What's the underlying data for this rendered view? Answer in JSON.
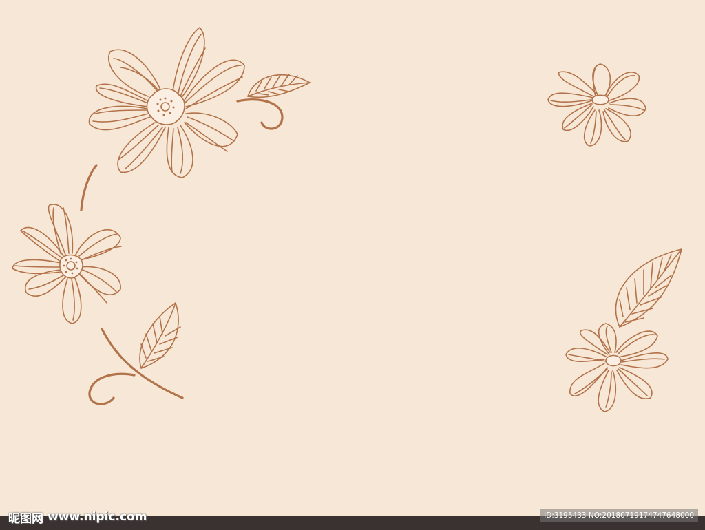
{
  "background_color": "#f7e7d6",
  "line_color": "#b2734a",
  "watermark": {
    "site_name": "昵图网",
    "site_url": "www.nipic.com",
    "image_id": "ID:3195433 NO:20180719174747648000"
  }
}
